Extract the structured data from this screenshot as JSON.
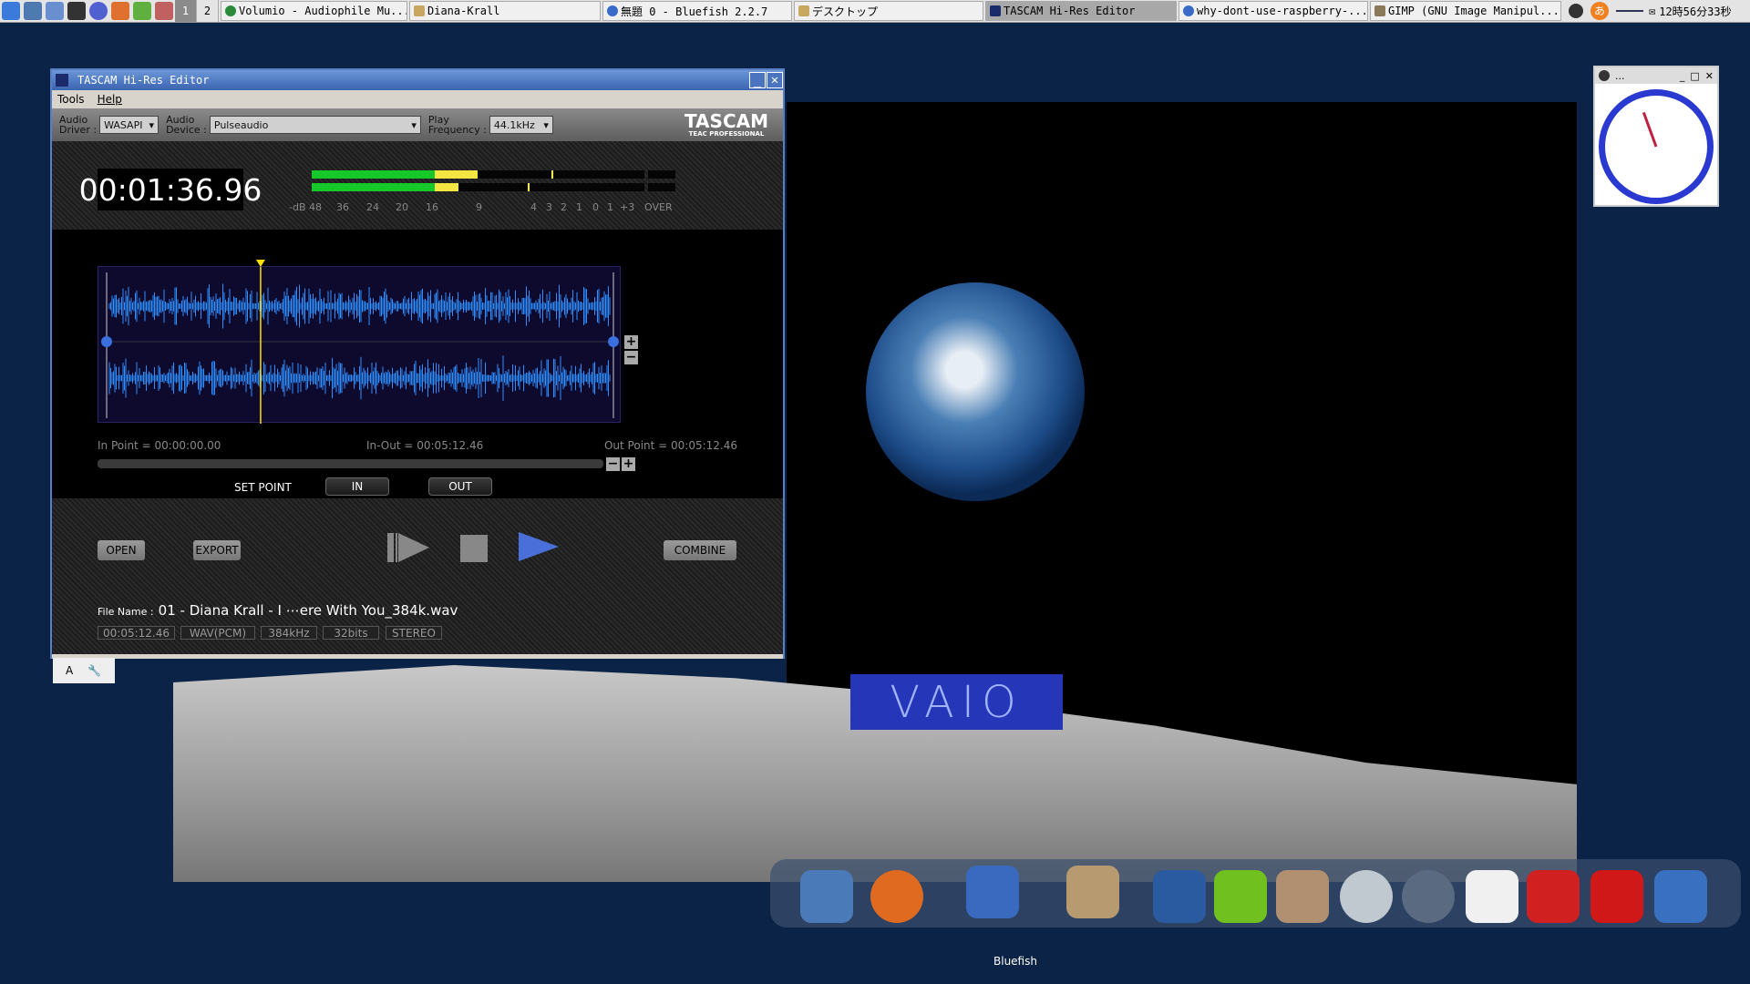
{
  "taskbar": {
    "workspaces": [
      "1",
      "2"
    ],
    "tasks": [
      {
        "label": "Volumio - Audiophile Mu...",
        "icon": "play-circle-icon",
        "active": false
      },
      {
        "label": "Diana-Krall",
        "icon": "folder-icon",
        "active": false
      },
      {
        "label": "無題 0 - Bluefish 2.2.7",
        "icon": "bluefish-icon",
        "active": false
      },
      {
        "label": "デスクトップ",
        "icon": "folder-icon",
        "active": false
      },
      {
        "label": "TASCAM Hi-Res Editor",
        "icon": "tascam-icon",
        "active": true
      },
      {
        "label": "why-dont-use-raspberry-...",
        "icon": "browser-icon",
        "active": false
      },
      {
        "label": "GIMP (GNU Image Manipul...",
        "icon": "gimp-icon",
        "active": false
      }
    ],
    "clock": "12時56分33秒",
    "ime": "あ"
  },
  "window": {
    "title": "TASCAM Hi-Res Editor",
    "menu": [
      "Tools",
      "Help"
    ],
    "toolbar": {
      "driver_label1": "Audio",
      "driver_label2": "Driver :",
      "driver_value": "WASAPI",
      "device_label1": "Audio",
      "device_label2": "Device :",
      "device_value": "Pulseaudio",
      "freq_label1": "Play",
      "freq_label2": "Frequency :",
      "freq_value": "44.1kHz",
      "logo": "TASCAM",
      "logo_sub": "TEAC PROFESSIONAL"
    },
    "timecode": "00:01:36.96",
    "meter": {
      "scale": [
        "-dB",
        "48",
        "36",
        "24",
        "20",
        "16",
        "9",
        "4",
        "3",
        "2",
        "1",
        "0",
        "1",
        "+3",
        "OVER"
      ],
      "left_level": 0.5,
      "right_level": 0.44,
      "left_peak": 0.72,
      "right_peak": 0.65,
      "colors": {
        "green": "#16c82a",
        "yellow": "#f4e642"
      }
    },
    "waveform": {
      "playhead_fraction": 0.31,
      "color": "#2f8fff"
    },
    "in_point": "In Point = 00:00:00.00",
    "in_out": "In-Out = 00:05:12.46",
    "out_point": "Out Point = 00:05:12.46",
    "set_point": "SET POINT",
    "in_btn": "IN",
    "out_btn": "OUT",
    "open_btn": "OPEN",
    "export_btn": "EXPORT",
    "combine_btn": "COMBINE",
    "file_label": "File Name :",
    "file_name": "01 - Diana Krall - I ⋯ere With You_384k.wav",
    "tags": [
      "00:05:12.46",
      "WAV(PCM)",
      "384kHz",
      "32bits",
      "STEREO"
    ]
  },
  "below_tab": {
    "a": "A"
  },
  "desktop": {
    "vaio": "VAIO"
  },
  "clock_widget": {
    "title": "..."
  },
  "dock": {
    "label": "Bluefish",
    "icons": [
      "file-manager-icon",
      "firefox-icon",
      "bluefish-icon",
      "gimp-icon",
      "libreoffice-icon",
      "skype-icon",
      "mail-icon",
      "music-icon",
      "globe-icon",
      "text-editor-icon",
      "apple-icon",
      "power-icon",
      "video-icon"
    ]
  }
}
